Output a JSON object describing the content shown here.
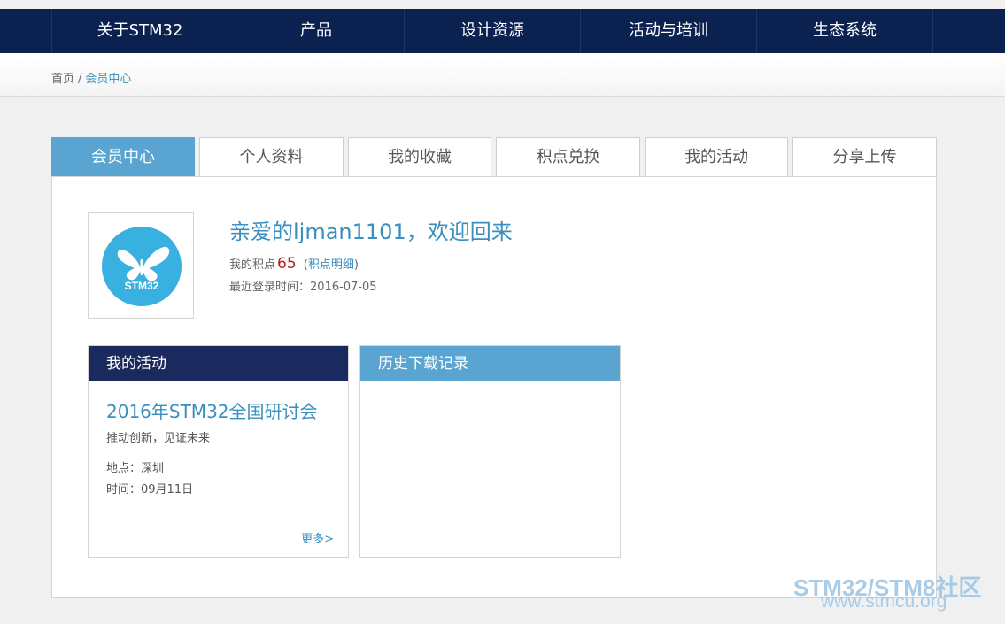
{
  "nav": {
    "items": [
      {
        "label": "关于STM32"
      },
      {
        "label": "产品"
      },
      {
        "label": "设计资源"
      },
      {
        "label": "活动与培训"
      },
      {
        "label": "生态系统"
      }
    ]
  },
  "breadcrumb": {
    "home": "首页",
    "separator": "/",
    "current": "会员中心"
  },
  "tabs": [
    {
      "label": "会员中心",
      "active": true
    },
    {
      "label": "个人资料",
      "active": false
    },
    {
      "label": "我的收藏",
      "active": false
    },
    {
      "label": "积点兑换",
      "active": false
    },
    {
      "label": "我的活动",
      "active": false
    },
    {
      "label": "分享上传",
      "active": false
    }
  ],
  "profile": {
    "avatar_icon": "stm32-butterfly-logo",
    "avatar_logo_text": "STM32",
    "welcome": "亲爱的ljman1101，欢迎回来",
    "points_label": "我的积点",
    "points_value": "65",
    "points_link_open": "(",
    "points_link": "积点明细",
    "points_link_close": ")",
    "last_login_label": "最近登录时间：",
    "last_login_value": "2016-07-05"
  },
  "activity_card": {
    "header": "我的活动",
    "event_title": "2016年STM32全国研讨会",
    "event_slogan": "推动创新，见证未来",
    "place_label": "地点：",
    "place_value": "深圳",
    "time_label": "时间：",
    "time_value": "09月11日",
    "more": "更多>"
  },
  "history_card": {
    "header": "历史下载记录"
  },
  "watermark": {
    "line1": "STM32/STM8社区",
    "line2": "www.stmcu.org"
  },
  "colors": {
    "nav_bg": "#0b2150",
    "accent_blue": "#5aa4d1",
    "link_blue": "#3a8fbe",
    "points_red": "#b22222",
    "activity_header_bg": "#1b2a5e"
  }
}
